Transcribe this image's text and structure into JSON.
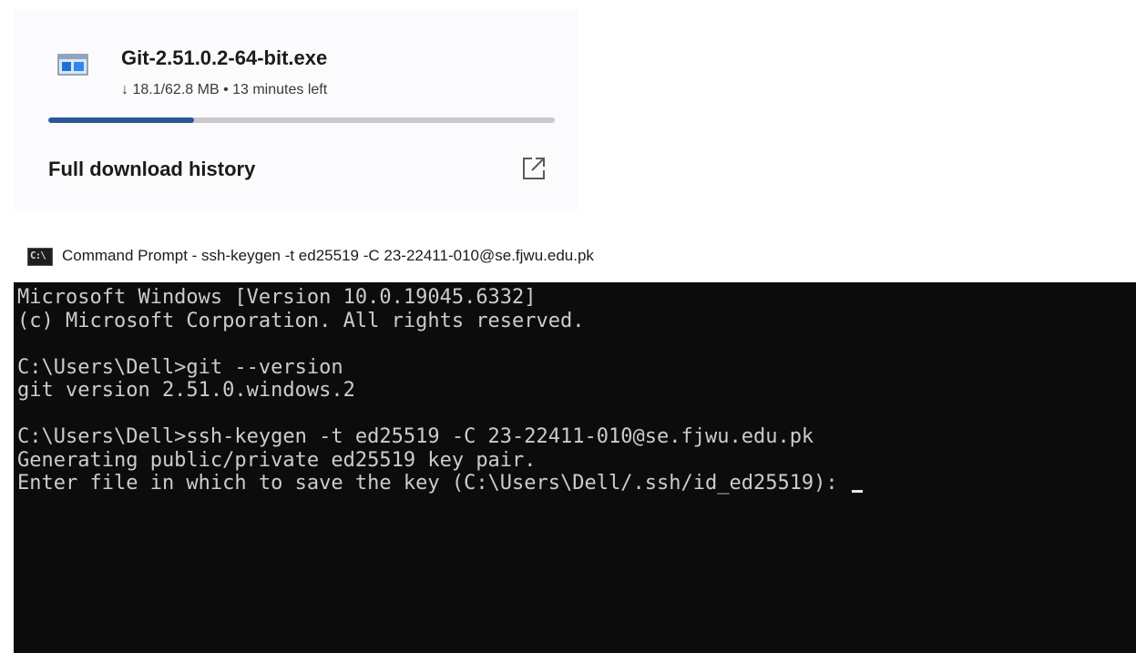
{
  "download": {
    "file_name": "Git-2.51.0.2-64-bit.exe",
    "status": "↓ 18.1/62.8 MB • 13 minutes left",
    "progress_fraction": 0.2882,
    "history_label": "Full download history",
    "file_icon": "installer-file-icon",
    "history_icon": "open-external-icon",
    "progress_color": "#2b5797"
  },
  "console_window": {
    "title": "Command Prompt - ssh-keygen  -t ed25519 -C 23-22411-010@se.fjwu.edu.pk",
    "icon_label": "C:\\",
    "lines": [
      "Microsoft Windows [Version 10.0.19045.6332]",
      "(c) Microsoft Corporation. All rights reserved.",
      "",
      "C:\\Users\\Dell>git --version",
      "git version 2.51.0.windows.2",
      "",
      "C:\\Users\\Dell>ssh-keygen -t ed25519 -C 23-22411-010@se.fjwu.edu.pk",
      "Generating public/private ed25519 key pair.",
      "Enter file in which to save the key (C:\\Users\\Dell/.ssh/id_ed25519): "
    ],
    "background": "#0c0c0c",
    "text_color": "#cccccc"
  }
}
